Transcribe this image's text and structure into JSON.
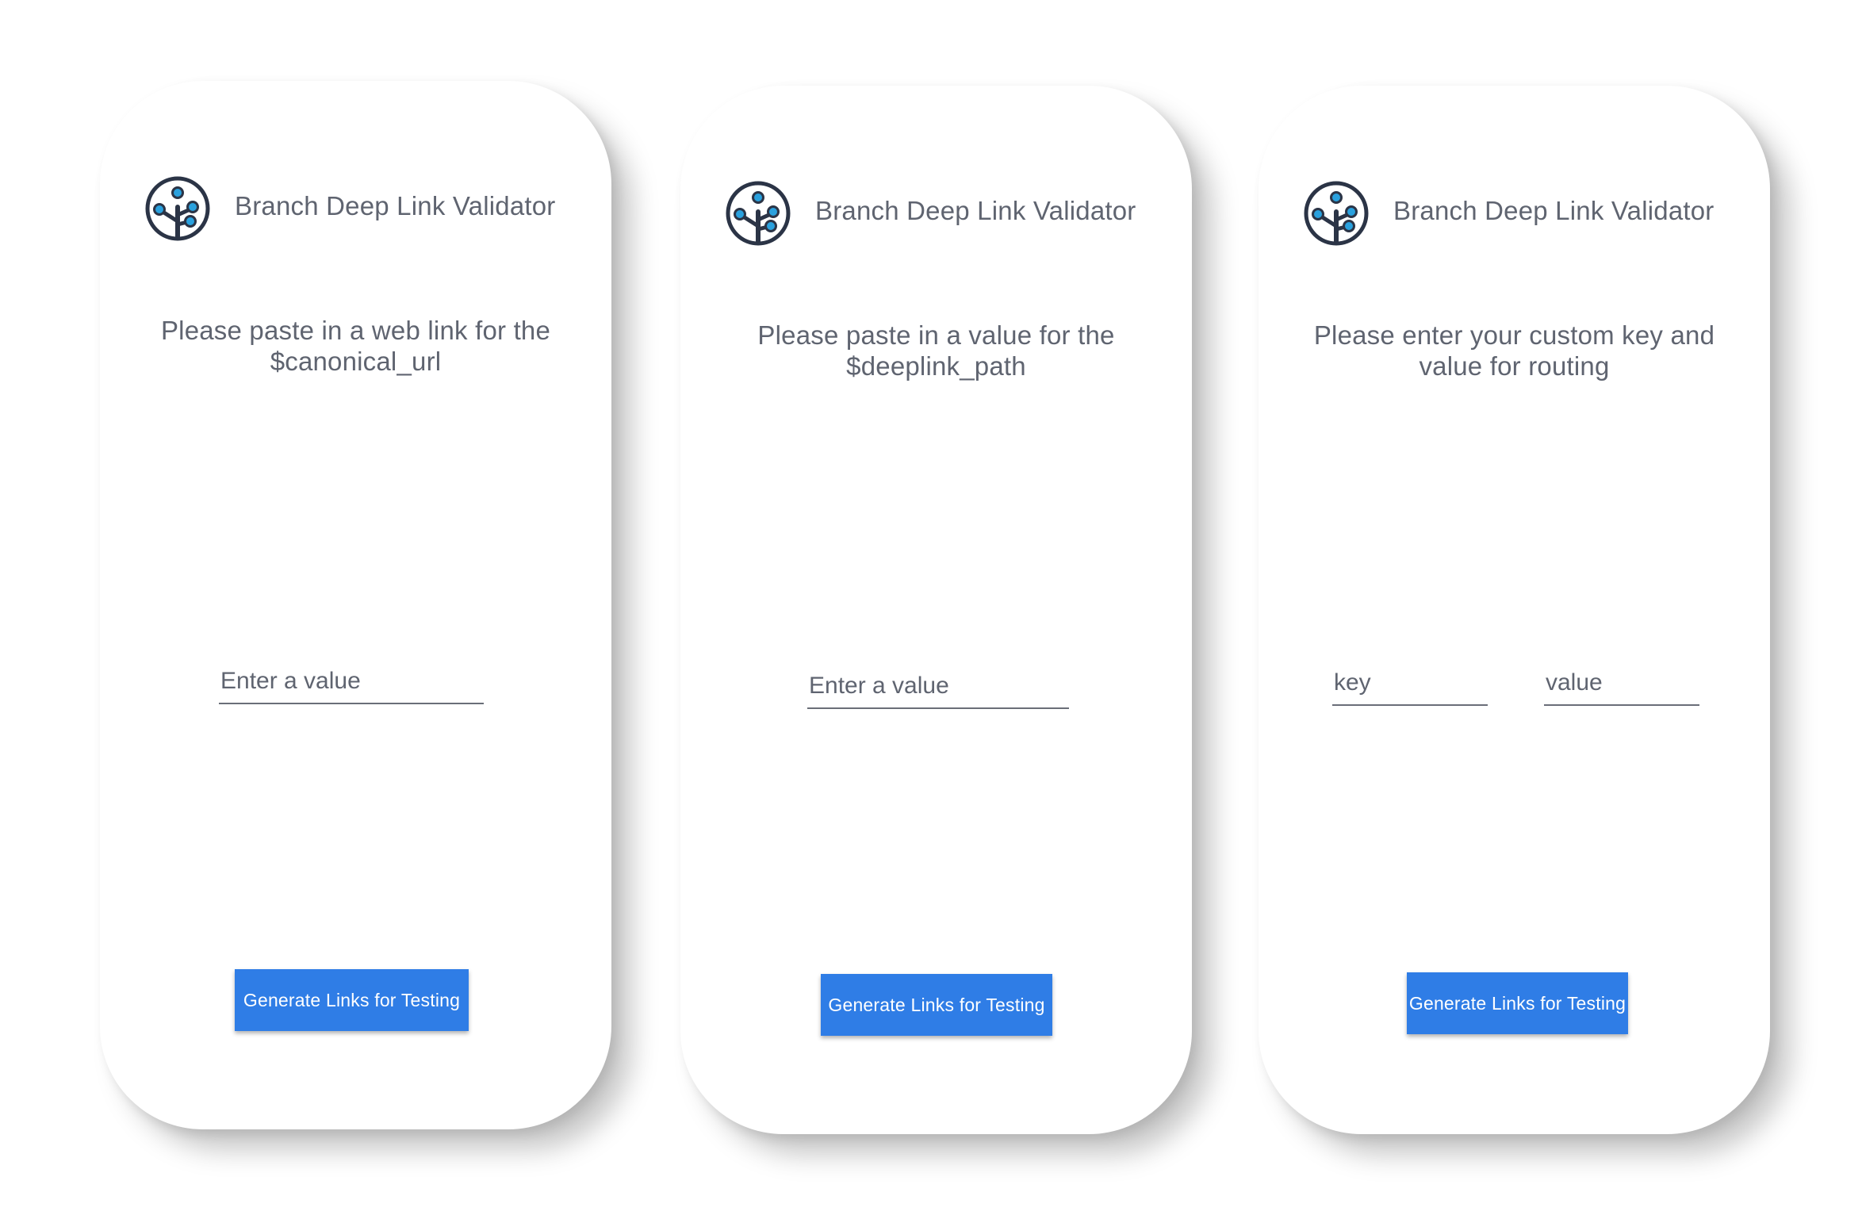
{
  "screens": [
    {
      "app_title": "Branch Deep Link Validator",
      "prompt_line1": "Please paste in a web link for the",
      "prompt_line2": "$canonical_url",
      "input_placeholder": "Enter a value",
      "button_label": "Generate Links for Testing",
      "logo_icon": "branch-tree-icon"
    },
    {
      "app_title": "Branch Deep Link Validator",
      "prompt_line1": "Please paste in a value for the",
      "prompt_line2": "$deeplink_path",
      "input_placeholder": "Enter a value",
      "button_label": "Generate Links for Testing",
      "logo_icon": "branch-tree-icon"
    },
    {
      "app_title": "Branch Deep Link Validator",
      "prompt_line1": "Please enter your custom key and",
      "prompt_line2": "value for routing",
      "key_placeholder": "key",
      "value_placeholder": "value",
      "button_label": "Generate Links for Testing",
      "logo_icon": "branch-tree-icon"
    }
  ],
  "colors": {
    "button_bg": "#2f7de6",
    "text_gray": "#5f6470",
    "logo_dark": "#2b3446",
    "logo_accent": "#2aa1de"
  }
}
